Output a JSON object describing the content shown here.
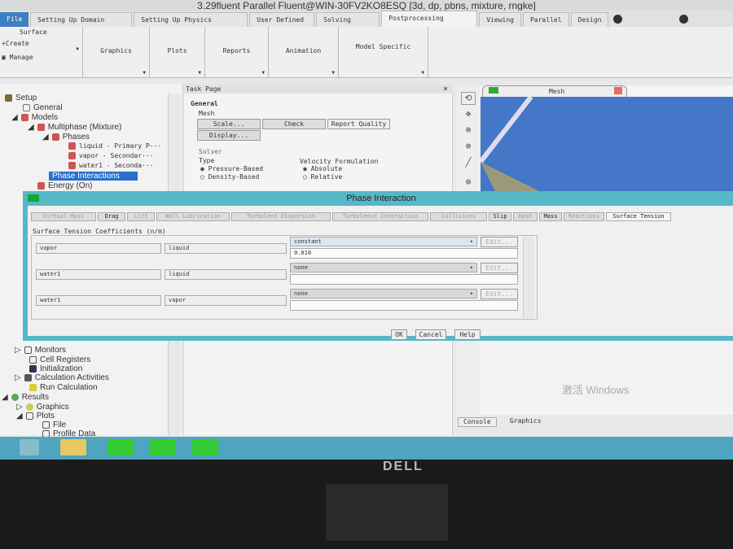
{
  "title": "3.29fluent Parallel Fluent@WIN-30FV2KO8ESQ  [3d, dp, pbns, mixture, rngke]",
  "ribbon_tabs": [
    "File",
    "Setting Up Domain",
    "Setting Up Physics",
    "User Defined",
    "Solving",
    "Postprocessing",
    "Viewing",
    "Parallel",
    "Design"
  ],
  "ribbon_groups": {
    "surface": "Surface",
    "create": "Create",
    "manage": "Manage",
    "graphics": "Graphics",
    "plots": "Plots",
    "reports": "Reports",
    "animation": "Animation",
    "model_specific": "Model Specific"
  },
  "tree": {
    "setup": "Setup",
    "general": "General",
    "models": "Models",
    "multiphase": "Multiphase (Mixture)",
    "phases": "Phases",
    "liquid": "liquid - Primary P···",
    "vapor": "vapor - Secondar···",
    "water1": "water1 - Seconda···",
    "phase_interactions": "Phase Interactions",
    "energy": "Energy (On)",
    "monitors": "Monitors",
    "cell_registers": "Cell Registers",
    "initialization": "Initialization",
    "calc_activities": "Calculation Activities",
    "run_calc": "Run Calculation",
    "results": "Results",
    "graphics": "Graphics",
    "plots": "Plots",
    "file": "File",
    "profile_data": "Profile Data"
  },
  "task_page": {
    "title": "Task Page",
    "general": "General",
    "mesh": "Mesh",
    "scale": "Scale...",
    "check": "Check",
    "report_quality": "Report Quality",
    "display": "Display...",
    "solver": "Solver",
    "type": "Type",
    "pressure_based": "Pressure-Based",
    "density_based": "Density-Based",
    "velocity_formulation": "Velocity Formulation",
    "absolute": "Absolute",
    "relative": "Relative"
  },
  "graphics_window": {
    "title": "Mesh",
    "console_tab": "Console",
    "graphics_tab": "Graphics",
    "watermark": "激活 Windows"
  },
  "dialog": {
    "title": "Phase Interaction",
    "tabs": [
      "Virtual Mass",
      "Drag",
      "Lift",
      "Wall Lubrication",
      "Turbulent Dispersion",
      "Turbulence Interaction",
      "Collisions",
      "Slip",
      "Heat",
      "Mass",
      "Reactions",
      "Surface Tension"
    ],
    "active_tab": "Surface Tension",
    "section": "Surface Tension Coefficients (n/m)",
    "rows": [
      {
        "a": "vapor",
        "b": "liquid",
        "method": "constant",
        "value": "0.010",
        "edit": "Edit..."
      },
      {
        "a": "water1",
        "b": "liquid",
        "method": "none",
        "value": "",
        "edit": "Edit..."
      },
      {
        "a": "water1",
        "b": "vapor",
        "method": "none",
        "value": "",
        "edit": "Edit..."
      }
    ],
    "ok": "OK",
    "cancel": "Cancel",
    "help": "Help"
  },
  "brand": "DELL"
}
